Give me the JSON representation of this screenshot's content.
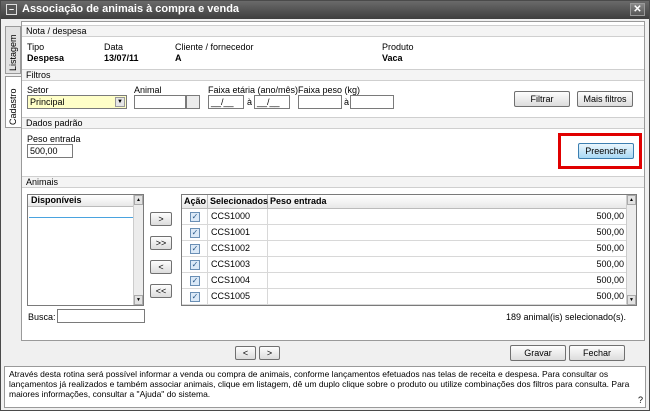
{
  "window": {
    "title": "Associação de animais à compra e venda"
  },
  "tabs": {
    "listagem": "Listagem",
    "cadastro": "Cadastro"
  },
  "nota": {
    "section": "Nota / despesa",
    "tipo_label": "Tipo",
    "tipo_value": "Despesa",
    "data_label": "Data",
    "data_value": "13/07/11",
    "cliente_label": "Cliente / fornecedor",
    "cliente_value": "A",
    "produto_label": "Produto",
    "produto_value": "Vaca"
  },
  "filtros": {
    "section": "Filtros",
    "setor_label": "Setor",
    "setor_value": "Principal",
    "animal_label": "Animal",
    "animal_value": "",
    "faixa_etaria_label": "Faixa etária (ano/mês)",
    "faixa_from": "__/__",
    "faixa_to": "__/__",
    "a1": "à",
    "faixa_peso_label": "Faixa peso (kg)",
    "peso_from": "",
    "peso_to": "",
    "a2": "à",
    "filtrar": "Filtrar",
    "mais_filtros": "Mais filtros"
  },
  "dados": {
    "section": "Dados padrão",
    "peso_label": "Peso entrada",
    "peso_value": "500,00",
    "preencher": "Preencher"
  },
  "animais": {
    "section": "Animais",
    "disponiveis": "Disponíveis",
    "move_one_right": ">",
    "move_all_right": ">>",
    "move_one_left": "<",
    "move_all_left": "<<",
    "col_acao": "Ação",
    "col_selecionados": "Selecionados",
    "col_peso": "Peso entrada",
    "rows": [
      {
        "id": "CCS1000",
        "peso": "500,00"
      },
      {
        "id": "CCS1001",
        "peso": "500,00"
      },
      {
        "id": "CCS1002",
        "peso": "500,00"
      },
      {
        "id": "CCS1003",
        "peso": "500,00"
      },
      {
        "id": "CCS1004",
        "peso": "500,00"
      },
      {
        "id": "CCS1005",
        "peso": "500,00"
      }
    ],
    "busca_label": "Busca:",
    "busca_value": "",
    "count": "189 animal(is) selecionado(s)."
  },
  "bottom": {
    "prev": "<",
    "next": ">",
    "gravar": "Gravar",
    "fechar": "Fechar"
  },
  "footer": {
    "text": "Através desta rotina será possível informar a venda ou compra de animais, conforme lançamentos efetuados nas telas de receita e despesa. Para consultar os lançamentos já realizados e também associar animais, clique em listagem, dê um duplo clique sobre o produto ou utilize combinações dos filtros para consulta. Para maiores informações, consultar a \"Ajuda\" do sistema.",
    "help": "?"
  }
}
